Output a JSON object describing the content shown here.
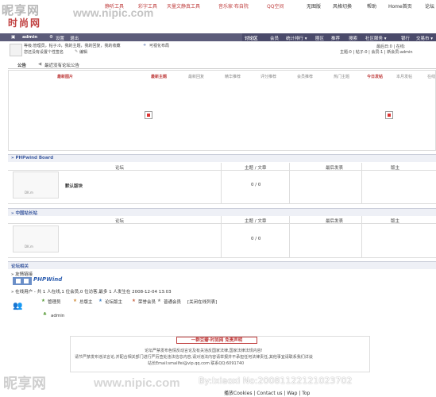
{
  "watermark": {
    "logo": "昵享网",
    "url": "www.nipic.com",
    "bottom_logo": "昵享网",
    "bottom_url": "www.nipic.com",
    "id_text": "By:lxiaoxi  No:20081122121023702"
  },
  "site": {
    "logo": "时尚网"
  },
  "top_links": [
    "静听工具",
    "彩字工具",
    "天量文静真工具",
    "音乐家·布自院",
    "QQ空间",
    "无图版",
    "风格切换",
    "帮助",
    "Home首页",
    "论坛"
  ],
  "userbar": {
    "username": "admin",
    "settings": "设置",
    "logout": "退出"
  },
  "nav": {
    "items": [
      "讨论区",
      "会员",
      "统计排行 ▾",
      "圈区",
      "推荐",
      "搜索",
      "社区服务 ▾",
      "银行",
      "交易市 ▾"
    ]
  },
  "info": {
    "line1": "等级:管理员，帖子:0，我的主题，我的回复，我的收藏",
    "visualize": "可视化布局",
    "line2": "您还没有设置个性签名",
    "edit": "编辑",
    "stats": "主题:0 | 帖子:0 | 会员:1 | 新会员:admin",
    "today": "最后日:0 | 在线:"
  },
  "announce": {
    "label": "公告",
    "text": "最近没有论坛公告"
  },
  "hot": {
    "headers": [
      "最新图片",
      "最新主题",
      "最新回复",
      "精华推荐",
      "评分推荐",
      "会员推荐",
      "热门主题",
      "今日发帖",
      "本月发帖",
      "在线"
    ]
  },
  "sections": [
    {
      "title": "» PHPwind Board",
      "cols": [
        "论坛",
        "主题 / 文章",
        "最后发表",
        "版主"
      ],
      "forum_name": "默认版块",
      "forum_img": "DK.m",
      "count": "0 / 0"
    },
    {
      "title": "» 中国站长站",
      "cols": [
        "论坛",
        "主题 / 文章",
        "最后发表",
        "版主"
      ],
      "forum_name": "",
      "forum_img": "DK.m",
      "count": "0 / 0"
    }
  ],
  "bottom_section": {
    "title": "论坛相关",
    "friend_links": "» 友情链接",
    "friend_logo": "PHPWind",
    "online_line": "» 在线用户 - 共 1 人在线,1 位会员,0 位访客,最多 1 人发生在 2008-12-04 13:03",
    "legend": [
      "管理员",
      "总版主",
      "论坛版主",
      "荣誉会员",
      "普通会员",
      "[关闭在线列表]"
    ],
    "online_user": "admin"
  },
  "footer": {
    "title": "一群豆瓣·时尚网 免责声明",
    "line1": "论坛严禁发布色情反动言论及有关违反国家法律,国家法律法规内容!",
    "line2": "请节严禁发布违法言论,并配合相关部门进行严厉查处违法信息内容,请对违法内容请举报并不承担任何法律责任,其他事宜请联系我们详谈",
    "line3": "站长Email:smallfei@vip.qq.com 联系QQ:6091740",
    "bottom_links": "播放Cookies | Contact us | Wap | Top"
  },
  "colors": {
    "accent": "#c04040",
    "navbar": "#4a4a6a",
    "userbar": "#5c5c7a",
    "section": "#3c5aa0"
  }
}
